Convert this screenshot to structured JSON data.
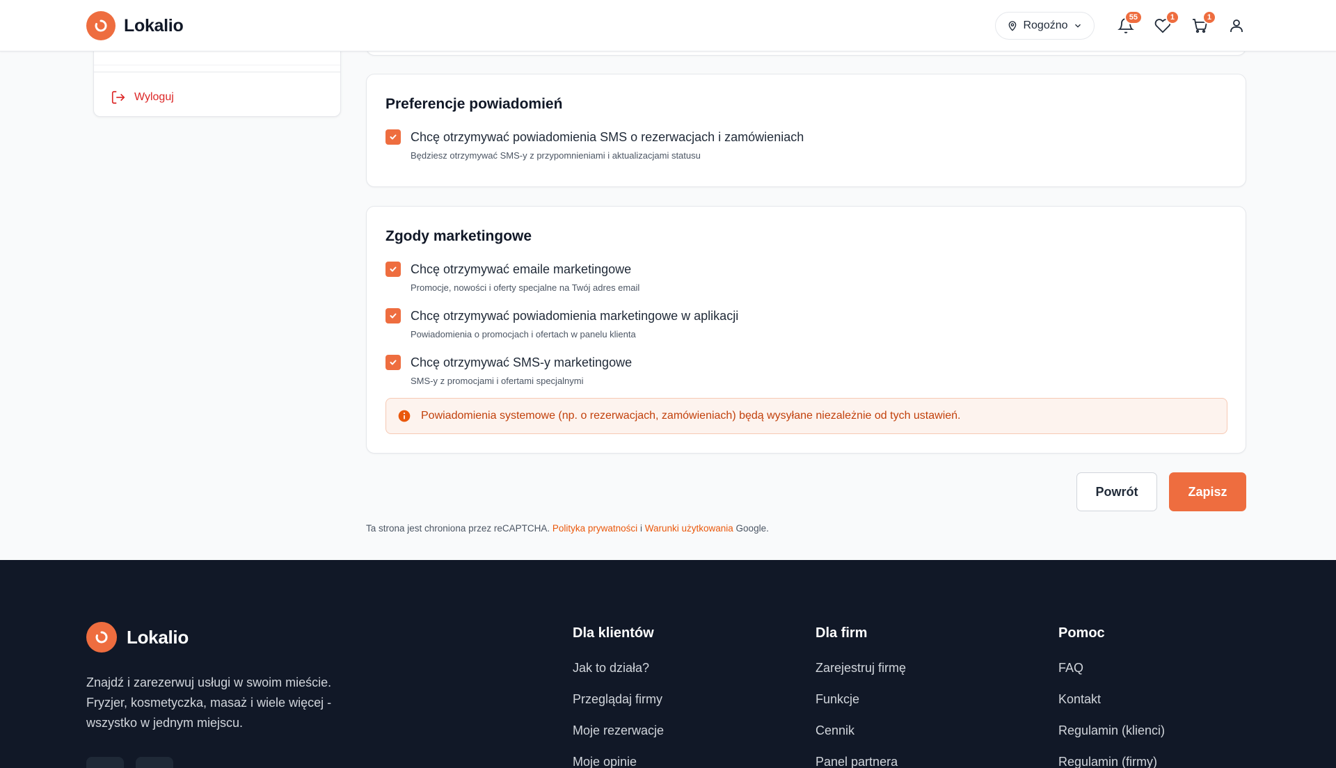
{
  "brand": {
    "name": "Lokalio",
    "accent": "#ee6d3f"
  },
  "header": {
    "city": "Rogoźno",
    "notifications_count": "55",
    "favorites_count": "1",
    "cart_count": "1"
  },
  "sidebar": {
    "logout_label": "Wyloguj"
  },
  "notifications_section": {
    "title": "Preferencje powiadomień",
    "options": [
      {
        "label": "Chcę otrzymywać powiadomienia SMS o rezerwacjach i zamówieniach",
        "description": "Będziesz otrzymywać SMS-y z przypomnieniami i aktualizacjami statusu",
        "checked": true
      }
    ]
  },
  "marketing_section": {
    "title": "Zgody marketingowe",
    "options": [
      {
        "label": "Chcę otrzymywać emaile marketingowe",
        "description": "Promocje, nowości i oferty specjalne na Twój adres email",
        "checked": true
      },
      {
        "label": "Chcę otrzymywać powiadomienia marketingowe w aplikacji",
        "description": "Powiadomienia o promocjach i ofertach w panelu klienta",
        "checked": true
      },
      {
        "label": "Chcę otrzymywać SMS-y marketingowe",
        "description": "SMS-y z promocjami i ofertami specjalnymi",
        "checked": true
      }
    ],
    "notice": "Powiadomienia systemowe (np. o rezerwacjach, zamówieniach) będą wysyłane niezależnie od tych ustawień."
  },
  "actions": {
    "back_label": "Powrót",
    "save_label": "Zapisz"
  },
  "captcha": {
    "prefix": "Ta strona jest chroniona przez reCAPTCHA.",
    "privacy_link": "Polityka prywatności",
    "and": "i",
    "terms_link": "Warunki użytkowania",
    "suffix": "Google."
  },
  "footer": {
    "brand": "Lokalio",
    "description": "Znajdź i zarezerwuj usługi w swoim mieście. Fryzjer, kosmetyczka, masaż i wiele więcej - wszystko w jednym miejscu.",
    "columns": [
      {
        "title": "Dla klientów",
        "links": [
          "Jak to działa?",
          "Przeglądaj firmy",
          "Moje rezerwacje",
          "Moje opinie"
        ]
      },
      {
        "title": "Dla firm",
        "links": [
          "Zarejestruj firmę",
          "Funkcje",
          "Cennik",
          "Panel partnera"
        ]
      },
      {
        "title": "Pomoc",
        "links": [
          "FAQ",
          "Kontakt",
          "Regulamin (klienci)",
          "Regulamin (firmy)"
        ]
      }
    ]
  }
}
